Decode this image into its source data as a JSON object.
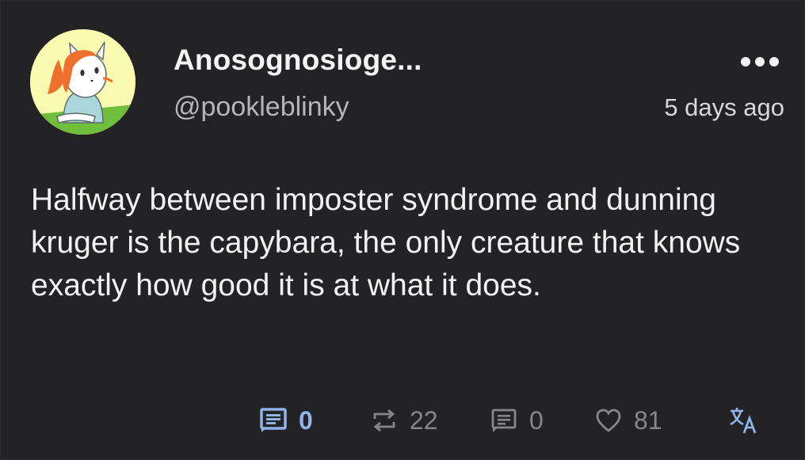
{
  "post": {
    "display_name": "Anosognosioge...",
    "handle": "@pookleblinky",
    "timestamp": "5 days ago",
    "text": "Halfway between imposter syndrome and dunning kruger is the capybara, the only creature that knows exactly how good it is at what it does."
  },
  "actions": {
    "reader_count": "0",
    "repost_count": "22",
    "comment_count": "0",
    "like_count": "81"
  },
  "icons": {
    "avatar": "cartoon-cat-avatar",
    "more": "more-horizontal-icon",
    "reader": "article-icon",
    "repost": "repost-icon",
    "comment": "comment-icon",
    "like": "heart-icon",
    "translate": "translate-icon"
  },
  "colors": {
    "background": "#232325",
    "text": "#f2f2f2",
    "muted": "#86868c",
    "accent": "#8fb4e8"
  }
}
